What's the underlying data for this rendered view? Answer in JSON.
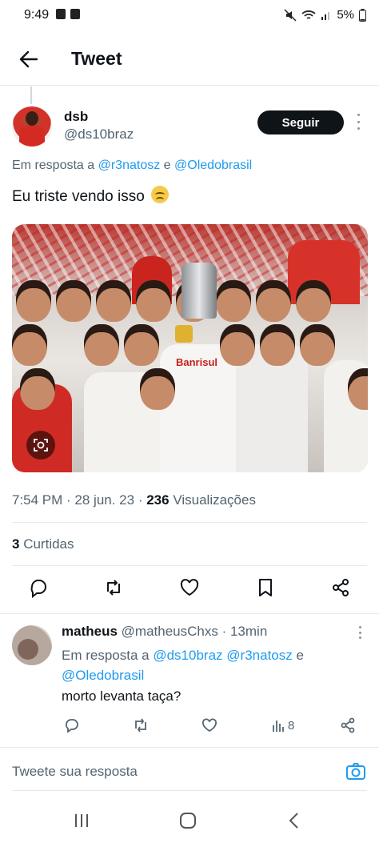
{
  "status_bar": {
    "time": "9:49",
    "battery": "5%"
  },
  "header": {
    "title": "Tweet"
  },
  "tweet": {
    "author_name": "dsb",
    "author_handle": "@ds10braz",
    "follow_label": "Seguir",
    "reply_prefix": "Em resposta a",
    "reply_mention_1": "@r3natosz",
    "reply_conj": "e",
    "reply_mention_2": "@Oledobrasil",
    "text": "Eu triste vendo isso",
    "emoji": "confounded-face-emoji",
    "timestamp": "7:54 PM · 28 jun. 23 ·",
    "views_count": "236",
    "views_label": "Visualizações",
    "likes_count": "3",
    "likes_label": "Curtidas",
    "photo_banner_text": "Banrisul",
    "actions": [
      "reply-icon",
      "retweet-icon",
      "like-icon",
      "bookmark-icon",
      "share-icon"
    ]
  },
  "reply": {
    "author_name": "matheus",
    "author_handle": "@matheusChxs",
    "time": "· 13min",
    "reply_prefix": "Em resposta a",
    "mention_1": "@ds10braz",
    "mention_2": "@r3natosz",
    "conj": "e",
    "mention_3": "@Oledobrasil",
    "text": "morto levanta taça?",
    "views": "8"
  },
  "compose": {
    "placeholder": "Tweete sua resposta"
  },
  "colors": {
    "link": "#1d9bf0",
    "text": "#0f1419",
    "secondary": "#536471"
  }
}
